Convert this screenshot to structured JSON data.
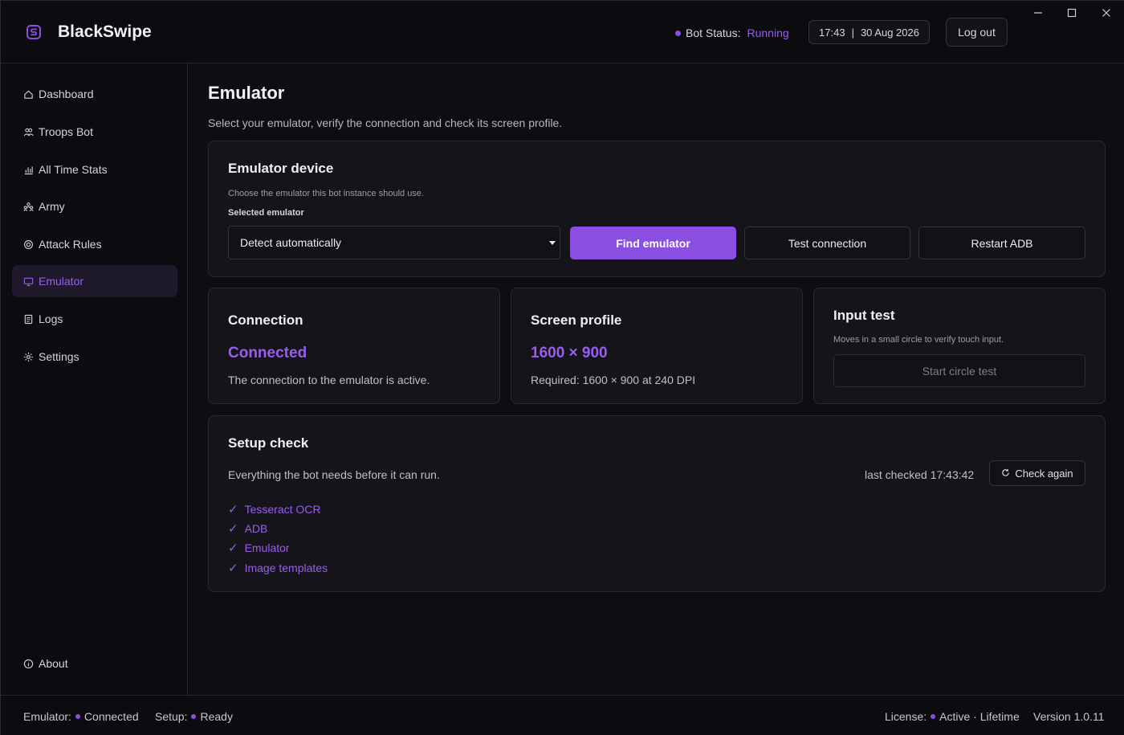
{
  "header": {
    "app_name": "BlackSwipe",
    "bot_status_label": "Bot Status:",
    "bot_status_value": "Running",
    "time": "17:43",
    "date_separator": "|",
    "date": "30 Aug 2026",
    "logout_label": "Log out"
  },
  "sidebar": {
    "items": [
      {
        "label": "Dashboard",
        "icon": "home-icon"
      },
      {
        "label": "Troops Bot",
        "icon": "users-icon"
      },
      {
        "label": "All Time Stats",
        "icon": "bar-chart-icon"
      },
      {
        "label": "Army",
        "icon": "group-icon"
      },
      {
        "label": "Attack Rules",
        "icon": "target-icon"
      },
      {
        "label": "Emulator",
        "icon": "monitor-icon",
        "active": true
      },
      {
        "label": "Logs",
        "icon": "document-icon"
      },
      {
        "label": "Settings",
        "icon": "gear-icon"
      }
    ],
    "about_label": "About"
  },
  "main": {
    "title": "Emulator",
    "subtitle": "Select your emulator, verify the connection and check its screen profile.",
    "device_card": {
      "title": "Emulator device",
      "description": "Choose the emulator this bot instance should use.",
      "field_label": "Selected emulator",
      "selected_value": "Detect automatically",
      "find_button": "Find emulator",
      "test_button": "Test connection",
      "restart_button": "Restart ADB"
    },
    "connection_card": {
      "title": "Connection",
      "value": "Connected",
      "description": "The connection to the emulator is active."
    },
    "screen_card": {
      "title": "Screen profile",
      "value": "1600 × 900",
      "description": "Required: 1600 × 900 at 240 DPI"
    },
    "input_card": {
      "title": "Input test",
      "description": "Moves in a small circle to verify touch input.",
      "button": "Start circle test"
    },
    "setup_card": {
      "title": "Setup check",
      "description": "Everything the bot needs before it can run.",
      "last_checked": "last checked 17:43:42",
      "check_button": "Check again",
      "items": [
        "Tesseract OCR",
        "ADB",
        "Emulator",
        "Image templates"
      ]
    }
  },
  "footer": {
    "emulator_label": "Emulator:",
    "emulator_value": "Connected",
    "setup_label": "Setup:",
    "setup_value": "Ready",
    "license_label": "License:",
    "license_value": "Active · Lifetime",
    "version": "Version 1.0.11"
  },
  "colors": {
    "accent": "#8a4fe0",
    "accent_text": "#9b5cf0",
    "background": "#0c0b10",
    "card": "#15141b"
  }
}
